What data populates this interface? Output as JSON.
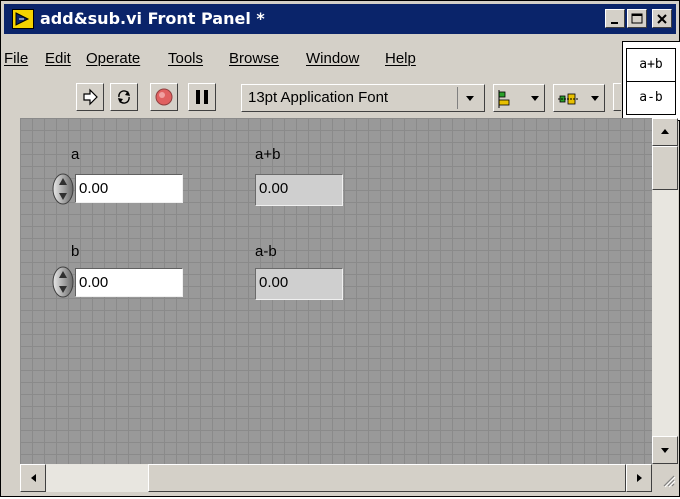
{
  "window": {
    "title": "add&sub.vi Front Panel *",
    "title_icon": "labview-vi-icon"
  },
  "menu": [
    "File",
    "Edit",
    "Operate",
    "Tools",
    "Browse",
    "Window",
    "Help"
  ],
  "toolbar": {
    "font": "13pt Application Font",
    "tools": [
      "run-arrow-icon",
      "run-continuously-icon",
      "abort-stop-icon",
      "pause-icon",
      "align-objects-icon",
      "distribute-objects-icon"
    ]
  },
  "connector_pane": {
    "top": "a+b",
    "bottom": "a-b"
  },
  "controls": [
    {
      "label": "a",
      "value": "0.00"
    },
    {
      "label": "b",
      "value": "0.00"
    }
  ],
  "indicators": [
    {
      "label": "a+b",
      "value": "0.00"
    },
    {
      "label": "a-b",
      "value": "0.00"
    }
  ],
  "colors": {
    "title_bar": "#0a246a",
    "panel_grid": "#999999",
    "chrome": "#d4d0c8"
  }
}
